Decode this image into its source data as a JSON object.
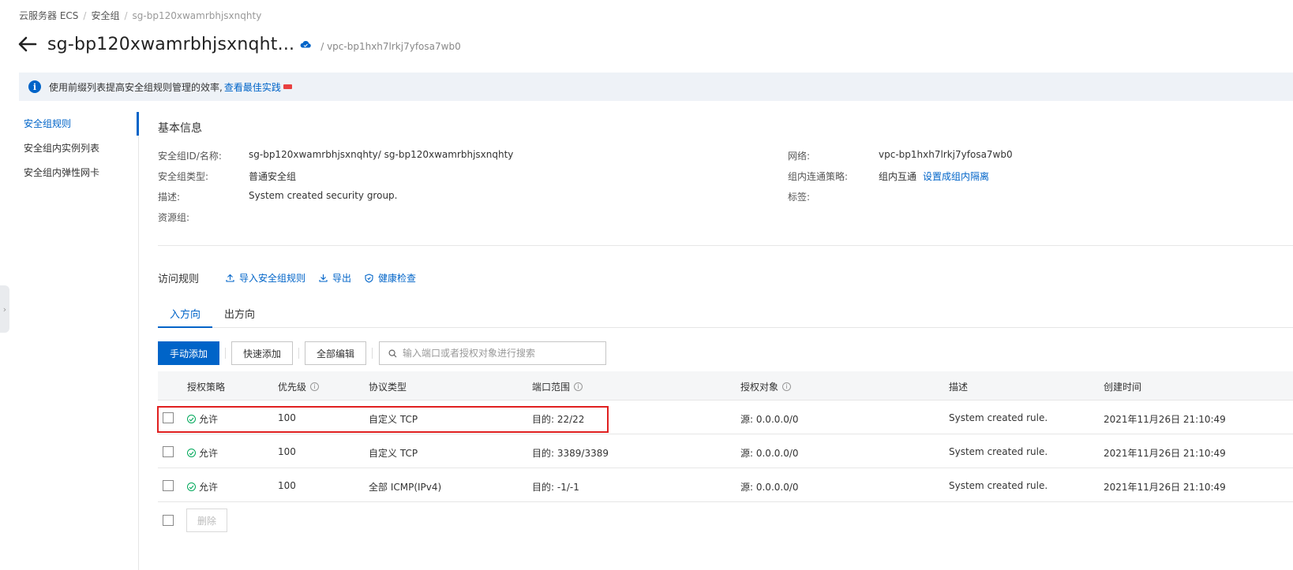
{
  "breadcrumb": {
    "root": "云服务器 ECS",
    "mid": "安全组",
    "current": "sg-bp120xwamrbhjsxnqhty",
    "sep": "/"
  },
  "header": {
    "title": "sg-bp120xwamrbhjsxnqht...",
    "vpc": "/ vpc-bp1hxh7lrkj7yfosa7wb0"
  },
  "notice": {
    "text": "使用前缀列表提高安全组规则管理的效率,",
    "link": "查看最佳实践"
  },
  "sidenav": {
    "items": [
      "安全组规则",
      "安全组内实例列表",
      "安全组内弹性网卡"
    ]
  },
  "basic_info": {
    "title": "基本信息",
    "left": [
      {
        "k": "安全组ID/名称:",
        "v": "sg-bp120xwamrbhjsxnqhty/ sg-bp120xwamrbhjsxnqhty"
      },
      {
        "k": "安全组类型:",
        "v": "普通安全组"
      },
      {
        "k": "描述:",
        "v": "System created security group."
      },
      {
        "k": "资源组:",
        "v": ""
      }
    ],
    "right": [
      {
        "k": "网络:",
        "v": "vpc-bp1hxh7lrkj7yfosa7wb0"
      },
      {
        "k": "组内连通策略:",
        "v": "组内互通",
        "link": "设置成组内隔离"
      },
      {
        "k": "标签:",
        "v": ""
      }
    ]
  },
  "rules": {
    "title": "访问规则",
    "actions": [
      "导入安全组规则",
      "导出",
      "健康检查"
    ],
    "tabs": [
      "入方向",
      "出方向"
    ]
  },
  "toolbar": {
    "manual_add": "手动添加",
    "quick_add": "快速添加",
    "edit_all": "全部编辑",
    "search_placeholder": "输入端口或者授权对象进行搜索"
  },
  "table": {
    "headers": [
      "授权策略",
      "优先级",
      "协议类型",
      "端口范围",
      "授权对象",
      "描述",
      "创建时间"
    ],
    "rows": [
      {
        "policy": "允许",
        "priority": "100",
        "protocol": "自定义 TCP",
        "port": "目的: 22/22",
        "source": "源: 0.0.0.0/0",
        "desc": "System created rule.",
        "time": "2021年11月26日 21:10:49"
      },
      {
        "policy": "允许",
        "priority": "100",
        "protocol": "自定义 TCP",
        "port": "目的: 3389/3389",
        "source": "源: 0.0.0.0/0",
        "desc": "System created rule.",
        "time": "2021年11月26日 21:10:49"
      },
      {
        "policy": "允许",
        "priority": "100",
        "protocol": "全部 ICMP(IPv4)",
        "port": "目的: -1/-1",
        "source": "源: 0.0.0.0/0",
        "desc": "System created rule.",
        "time": "2021年11月26日 21:10:49"
      }
    ],
    "delete_label": "删除"
  },
  "colors": {
    "accent": "#0064c8",
    "highlight": "#e02020",
    "allow": "#00a85a"
  }
}
